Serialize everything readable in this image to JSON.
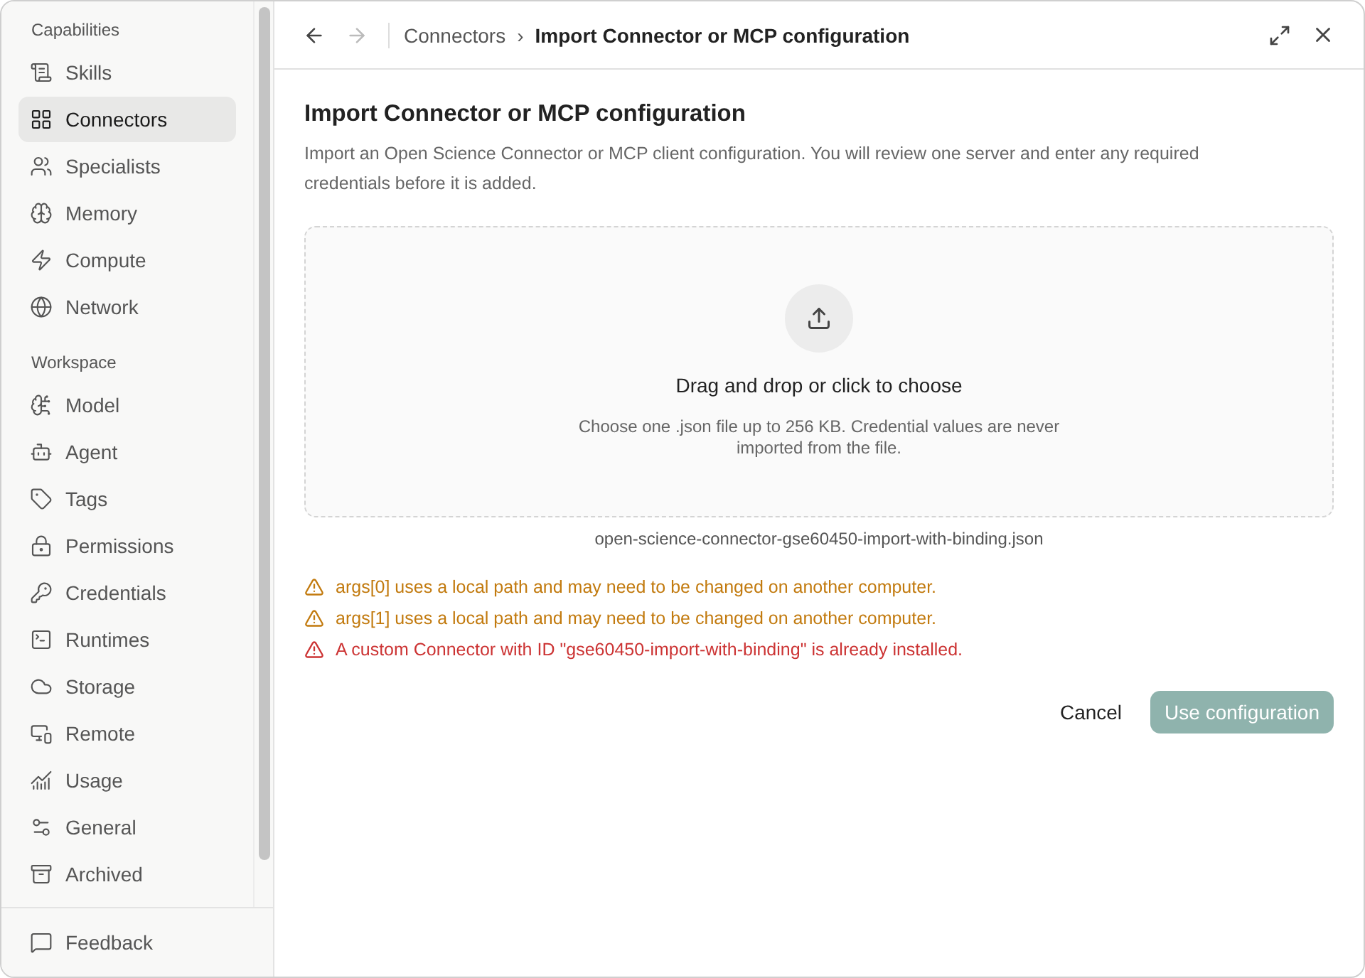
{
  "sidebar": {
    "sections": [
      {
        "title": "Capabilities",
        "items": [
          {
            "label": "Skills",
            "selected": false
          },
          {
            "label": "Connectors",
            "selected": true
          },
          {
            "label": "Specialists",
            "selected": false
          },
          {
            "label": "Memory",
            "selected": false
          },
          {
            "label": "Compute",
            "selected": false
          },
          {
            "label": "Network",
            "selected": false
          }
        ]
      },
      {
        "title": "Workspace",
        "items": [
          {
            "label": "Model",
            "selected": false
          },
          {
            "label": "Agent",
            "selected": false
          },
          {
            "label": "Tags",
            "selected": false
          },
          {
            "label": "Permissions",
            "selected": false
          },
          {
            "label": "Credentials",
            "selected": false
          },
          {
            "label": "Runtimes",
            "selected": false
          },
          {
            "label": "Storage",
            "selected": false
          },
          {
            "label": "Remote",
            "selected": false
          },
          {
            "label": "Usage",
            "selected": false
          },
          {
            "label": "General",
            "selected": false
          },
          {
            "label": "Archived",
            "selected": false
          }
        ]
      }
    ],
    "footer": {
      "label": "Feedback"
    }
  },
  "header": {
    "breadcrumb": [
      "Connectors",
      "Import Connector or MCP configuration"
    ],
    "separator": "›"
  },
  "dialog": {
    "title": "Import Connector or MCP configuration",
    "description": "Import an Open Science Connector or MCP client configuration. You will review one server and enter any required credentials before it is added.",
    "dropzone": {
      "title": "Drag and drop or click to choose",
      "hint": "Choose one .json file up to 256 KB. Credential values are never imported from the file."
    },
    "filename": "open-science-connector-gse60450-import-with-binding.json",
    "messages": [
      {
        "kind": "warning",
        "text": "args[0] uses a local path and may need to be changed on another computer."
      },
      {
        "kind": "warning",
        "text": "args[1] uses a local path and may need to be changed on another computer."
      },
      {
        "kind": "error",
        "text": "A custom Connector with ID \"gse60450-import-with-binding\" is already installed."
      }
    ],
    "buttons": {
      "cancel": "Cancel",
      "confirm": "Use configuration",
      "confirm_disabled": true
    }
  }
}
